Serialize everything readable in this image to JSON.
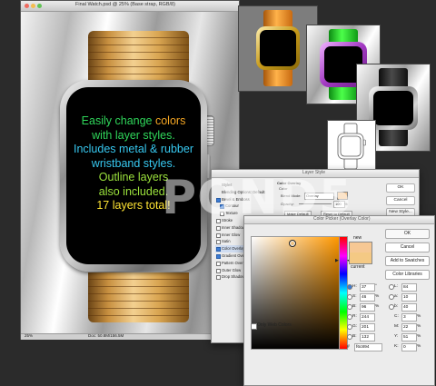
{
  "document": {
    "title": "Final Watch.psd @ 25% (Base strap, RGB/8)",
    "zoom": "25%",
    "doc_size": "Doc: 50.8M/156.5M"
  },
  "watch": {
    "promo_lines": [
      {
        "parts": [
          {
            "text": "Easily change ",
            "color": "green"
          },
          {
            "text": "colors",
            "color": "orange"
          }
        ]
      },
      {
        "parts": [
          {
            "text": "with layer styles.",
            "color": "green"
          }
        ]
      },
      {
        "parts": [
          {
            "text": "Includes metal & rubber",
            "color": "cyan"
          }
        ]
      },
      {
        "parts": [
          {
            "text": "wristband styles.",
            "color": "cyan"
          }
        ]
      },
      {
        "parts": [
          {
            "text": "Outline layers",
            "color": "lime"
          }
        ]
      },
      {
        "parts": [
          {
            "text": "also included.",
            "color": "lime"
          }
        ]
      },
      {
        "parts": [
          {
            "text": "17 layers total!",
            "color": "yellow"
          }
        ]
      }
    ],
    "line1a": "Easily change ",
    "line1b": "colors",
    "line2": "with layer styles.",
    "line3": "Includes metal & rubber",
    "line4": "wristband styles.",
    "line5": "Outline layers",
    "line6": "also included.",
    "line7": "17 layers total!"
  },
  "colors": {
    "band_gold": "#d9a551",
    "band_orange": "#f08a1c",
    "band_green": "#39e03f",
    "band_black": "#1d1d1d",
    "text_green": "#2fd65a",
    "text_orange": "#f5a623",
    "text_cyan": "#37c8f0",
    "text_lime": "#9be23c",
    "text_yellow": "#ffe433",
    "picked": "#f6c894"
  },
  "layer_style": {
    "title": "Layer Style",
    "items": [
      {
        "label": "Styles",
        "checked": false,
        "active": false
      },
      {
        "label": "Blending Options: Default",
        "checked": false,
        "active": false
      },
      {
        "label": "Bevel & Emboss",
        "checked": true,
        "active": false
      },
      {
        "label": "Contour",
        "checked": true,
        "active": false
      },
      {
        "label": "Texture",
        "checked": false,
        "active": false
      },
      {
        "label": "Stroke",
        "checked": false,
        "active": false
      },
      {
        "label": "Inner Shadow",
        "checked": false,
        "active": false
      },
      {
        "label": "Inner Glow",
        "checked": false,
        "active": false
      },
      {
        "label": "Satin",
        "checked": false,
        "active": false
      },
      {
        "label": "Color Overlay",
        "checked": true,
        "active": true
      },
      {
        "label": "Gradient Overlay",
        "checked": true,
        "active": false
      },
      {
        "label": "Pattern Overlay",
        "checked": false,
        "active": false
      },
      {
        "label": "Outer Glow",
        "checked": false,
        "active": false
      },
      {
        "label": "Drop Shadow",
        "checked": false,
        "active": false
      }
    ],
    "overlay_heading": "Color Overlay",
    "overlay_sub": "Color",
    "blend_mode_label": "Blend Mode:",
    "blend_mode_value": "Overlay",
    "opacity_label": "Opacity:",
    "opacity_value": "100",
    "opacity_unit": "%",
    "make_default": "Make Default",
    "reset_default": "Reset to Default",
    "buttons": {
      "ok": "OK",
      "cancel": "Cancel",
      "new_style": "New Style...",
      "preview": "Preview"
    }
  },
  "color_picker": {
    "title": "Color Picker (Overlay Color)",
    "new_label": "new",
    "current_label": "current",
    "buttons": {
      "ok": "OK",
      "cancel": "Cancel",
      "add_swatches": "Add to Swatches",
      "libraries": "Color Libraries"
    },
    "only_web_colors": "Only Web Colors",
    "hex_label": "#",
    "hex_value": "f6c894",
    "values": {
      "H": {
        "value": "37",
        "unit": "°"
      },
      "S": {
        "value": "46",
        "unit": "%"
      },
      "B": {
        "value": "96",
        "unit": "%"
      },
      "R": {
        "value": "244",
        "unit": ""
      },
      "G": {
        "value": "201",
        "unit": ""
      },
      "Bl": {
        "value": "132",
        "unit": ""
      },
      "L": {
        "value": "84",
        "unit": ""
      },
      "a": {
        "value": "10",
        "unit": ""
      },
      "b": {
        "value": "40",
        "unit": ""
      },
      "C": {
        "value": "3",
        "unit": "%"
      },
      "M": {
        "value": "22",
        "unit": "%"
      },
      "Y": {
        "value": "51",
        "unit": "%"
      },
      "K": {
        "value": "0",
        "unit": "%"
      }
    }
  },
  "watermark": "POND5"
}
